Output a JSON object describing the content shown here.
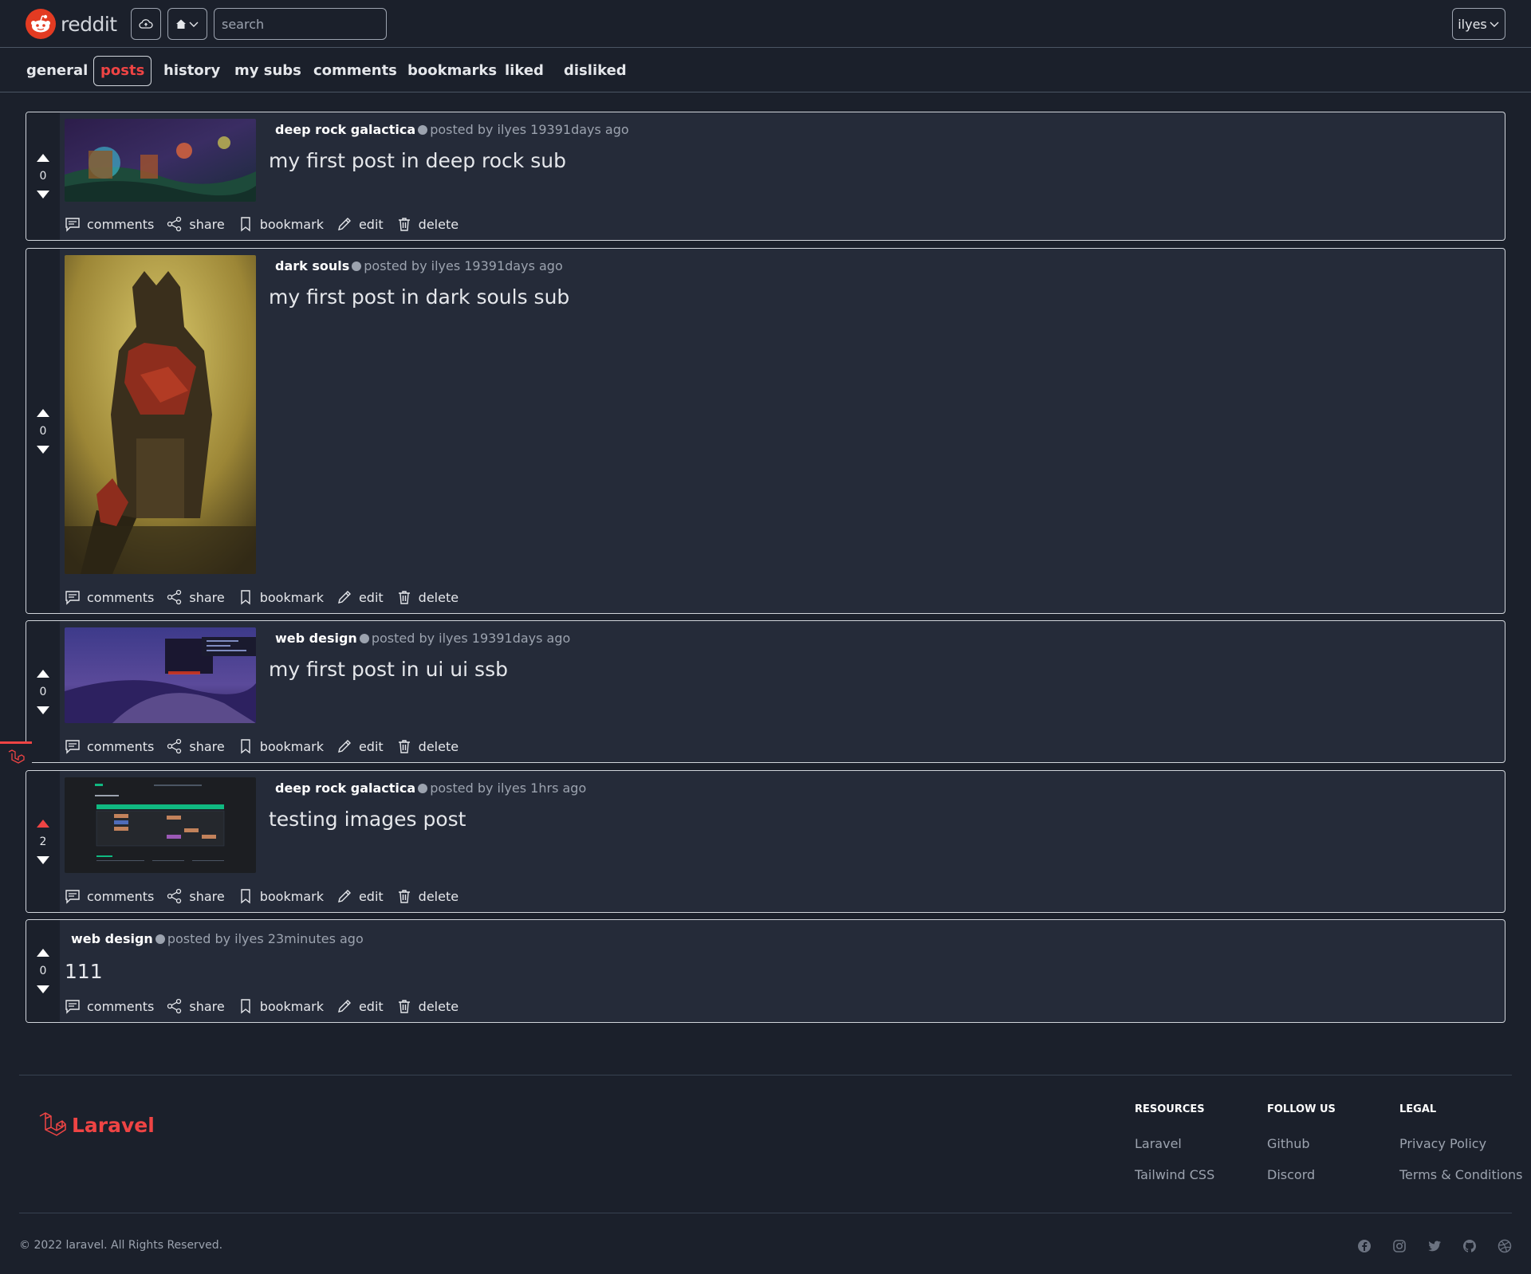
{
  "header": {
    "logo_text": "reddit",
    "search_placeholder": "search",
    "user_name": "ilyes"
  },
  "tabs": [
    {
      "label": "general",
      "active": false
    },
    {
      "label": "posts",
      "active": true
    },
    {
      "label": "history",
      "active": false
    },
    {
      "label": "my subs",
      "active": false
    },
    {
      "label": "comments",
      "active": false
    },
    {
      "label": "bookmarks",
      "active": false
    },
    {
      "label": "liked",
      "active": false
    },
    {
      "label": "disliked",
      "active": false
    }
  ],
  "actions": {
    "comments": "comments",
    "share": "share",
    "bookmark": "bookmark",
    "edit": "edit",
    "delete": "delete"
  },
  "posts": [
    {
      "sub": "deep rock galactica",
      "meta": "posted by ilyes 19391days ago",
      "title": "my first post in deep rock sub",
      "votes": "0",
      "upvoted": false,
      "has_image": true,
      "image": "deep-rock-art"
    },
    {
      "sub": "dark souls",
      "meta": "posted by ilyes 19391days ago",
      "title": "my first post in dark souls sub",
      "votes": "0",
      "upvoted": false,
      "has_image": true,
      "image": "dark-souls-art"
    },
    {
      "sub": "web design",
      "meta": "posted by ilyes 19391days ago",
      "title": "my first post in ui ui ssb",
      "votes": "0",
      "upvoted": false,
      "has_image": true,
      "image": "desktop-screenshot"
    },
    {
      "sub": "deep rock galactica",
      "meta": "posted by ilyes 1hrs ago",
      "title": "testing images post",
      "votes": "2",
      "upvoted": true,
      "has_image": true,
      "image": "calendar-screenshot"
    },
    {
      "sub": "web design",
      "meta": "posted by ilyes 23minutes ago",
      "title": "111",
      "votes": "0",
      "upvoted": false,
      "has_image": false
    }
  ],
  "footer": {
    "logo_text": "Laravel",
    "resources": {
      "heading": "RESOURCES",
      "links": [
        "Laravel",
        "Tailwind CSS"
      ]
    },
    "follow": {
      "heading": "FOLLOW US",
      "links": [
        "Github",
        "Discord"
      ]
    },
    "legal": {
      "heading": "LEGAL",
      "links": [
        "Privacy Policy",
        "Terms & Conditions"
      ]
    },
    "copyright": "© 2022 laravel. All Rights Reserved.",
    "social_icons": [
      "facebook-icon",
      "instagram-icon",
      "twitter-icon",
      "github-icon",
      "dribbble-icon"
    ]
  },
  "colors": {
    "accent": "#ef4444",
    "background": "#1b202b",
    "card": "#252b39",
    "reddit_orange": "#e33b22"
  }
}
